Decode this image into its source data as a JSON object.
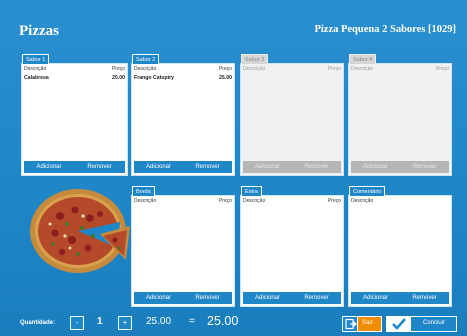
{
  "header": {
    "title": "Pizzas",
    "product": "Pizza Pequena 2 Sabores [1029]"
  },
  "columns": {
    "description": "Descrição",
    "price": "Preço"
  },
  "flavors": [
    {
      "label": "Sabor 1",
      "item": "Calabresa",
      "price": "20.00",
      "add": "Adicionar",
      "remove": "Remover"
    },
    {
      "label": "Sabor 2",
      "item": "Frango Catupiry",
      "price": "25.00",
      "add": "Adicionar",
      "remove": "Remover"
    },
    {
      "label": "Sabor 3",
      "add": "Adicionar",
      "remove": "Remover"
    },
    {
      "label": "Sabor 4",
      "add": "Adicionar",
      "remove": "Remover"
    }
  ],
  "extras": [
    {
      "label": "Borda",
      "add": "Adicionar",
      "remove": "Remover"
    },
    {
      "label": "Extra",
      "add": "Adicionar",
      "remove": "Remover"
    },
    {
      "label": "Comentário",
      "add": "Adicionar",
      "remove": "Remover"
    }
  ],
  "footer": {
    "qty_label": "Quantidade:",
    "minus": "-",
    "qty": "1",
    "plus": "+",
    "unit_price": "25.00",
    "eq": "=",
    "total": "25.00",
    "exit": "Sair",
    "confirm": "Concluir"
  },
  "colors": {
    "accent": "#1f86c8",
    "exit": "#f28c00"
  }
}
